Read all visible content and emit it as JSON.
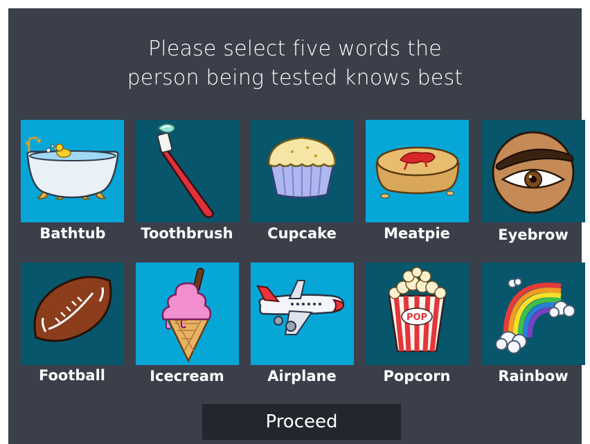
{
  "prompt": {
    "line1": "Please select five words the",
    "line2": "person being tested knows best"
  },
  "colors": {
    "background": "#3b3f49",
    "tile_selected": "#06a6d7",
    "tile_unselected": "#07566b",
    "button": "#22262d",
    "text": "#ffffff"
  },
  "words": [
    {
      "label": "Bathtub",
      "icon": "bathtub-icon",
      "selected": true
    },
    {
      "label": "Toothbrush",
      "icon": "toothbrush-icon",
      "selected": false
    },
    {
      "label": "Cupcake",
      "icon": "cupcake-icon",
      "selected": false
    },
    {
      "label": "Meatpie",
      "icon": "meatpie-icon",
      "selected": true
    },
    {
      "label": "Eyebrow",
      "icon": "eyebrow-icon",
      "selected": false
    },
    {
      "label": "Football",
      "icon": "football-icon",
      "selected": false
    },
    {
      "label": "Icecream",
      "icon": "icecream-icon",
      "selected": true
    },
    {
      "label": "Airplane",
      "icon": "airplane-icon",
      "selected": true
    },
    {
      "label": "Popcorn",
      "icon": "popcorn-icon",
      "selected": false
    },
    {
      "label": "Rainbow",
      "icon": "rainbow-icon",
      "selected": false
    }
  ],
  "proceed_label": "Proceed"
}
